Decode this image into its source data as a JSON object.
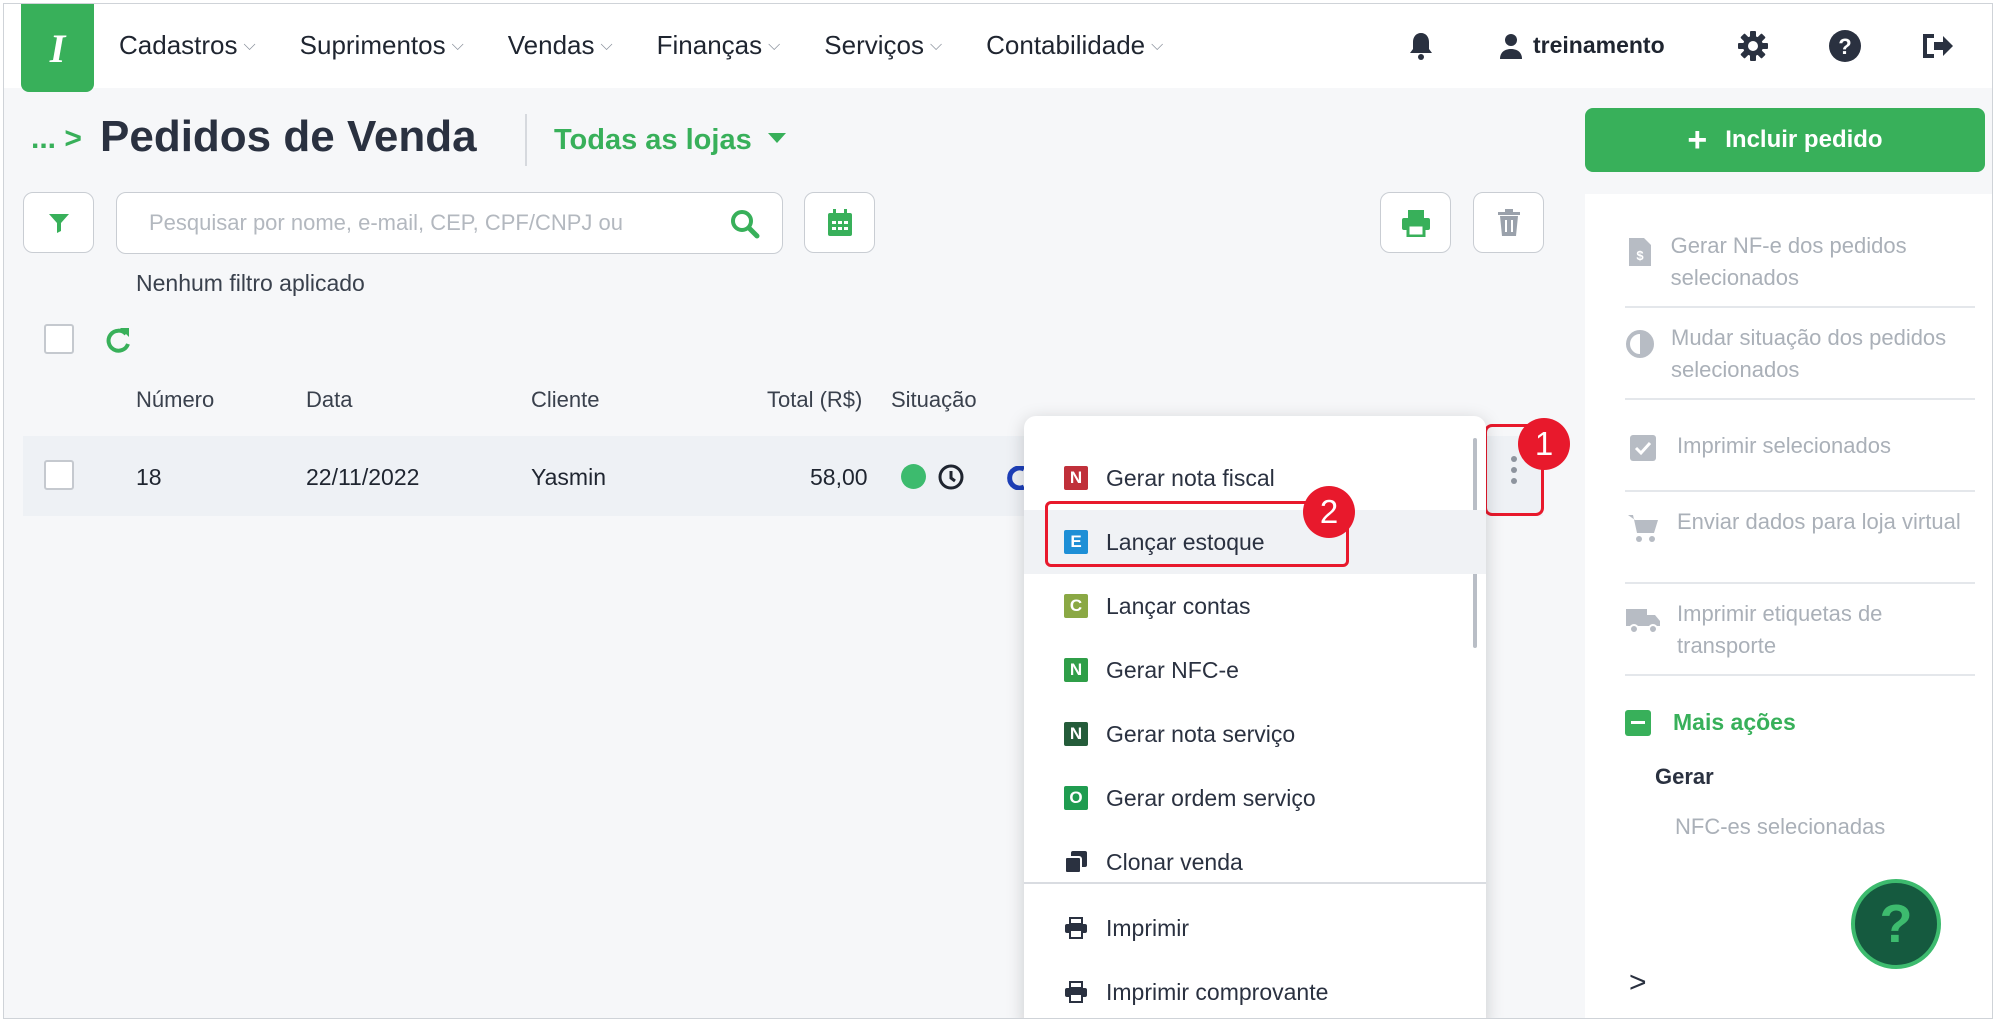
{
  "app": {
    "logo_letter": "I"
  },
  "nav": {
    "menu": [
      "Cadastros",
      "Suprimentos",
      "Vendas",
      "Finanças",
      "Serviços",
      "Contabilidade"
    ],
    "user": "treinamento"
  },
  "page": {
    "breadcrumb": "...",
    "title": "Pedidos de Venda",
    "store_selector": "Todas as lojas",
    "add_button": "Incluir pedido"
  },
  "toolbar": {
    "search_placeholder": "Pesquisar por nome, e-mail, CEP, CPF/CNPJ ou",
    "filter_status": "Nenhum filtro aplicado"
  },
  "table": {
    "columns": [
      "Número",
      "Data",
      "Cliente",
      "Total (R$)",
      "Situação"
    ],
    "rows": [
      {
        "numero": "18",
        "data": "22/11/2022",
        "cliente": "Yasmin",
        "total": "58,00",
        "status_color": "#3dbb6e"
      }
    ]
  },
  "dropdown": {
    "items": [
      {
        "label": "Gerar nota fiscal",
        "letter": "N",
        "color": "#c0303a"
      },
      {
        "label": "Lançar estoque",
        "letter": "E",
        "color": "#1e8fd6"
      },
      {
        "label": "Lançar contas",
        "letter": "C",
        "color": "#8aa844"
      },
      {
        "label": "Gerar NFC-e",
        "letter": "N",
        "color": "#2f9e48"
      },
      {
        "label": "Gerar nota serviço",
        "letter": "N",
        "color": "#245c3a"
      },
      {
        "label": "Gerar ordem serviço",
        "letter": "O",
        "color": "#1f9c50"
      },
      {
        "label": "Clonar venda",
        "icon": "clone-icon"
      },
      {
        "label": "Imprimir",
        "icon": "print-icon"
      },
      {
        "label": "Imprimir comprovante",
        "icon": "print-icon"
      }
    ]
  },
  "annotations": {
    "badge1": "1",
    "badge2": "2"
  },
  "sidebar": {
    "actions": [
      {
        "label": "Gerar NF-e dos pedidos selecionados",
        "icon": "invoice-file-icon"
      },
      {
        "label": "Mudar situação dos pedidos selecionados",
        "icon": "half-circle-icon"
      },
      {
        "label": "Imprimir selecionados",
        "icon": "checkbox-icon"
      },
      {
        "label": "Enviar dados para loja virtual",
        "icon": "cart-icon"
      },
      {
        "label": "Imprimir etiquetas de transporte",
        "icon": "truck-icon"
      }
    ],
    "more_actions": "Mais ações",
    "group": "Gerar",
    "group_item": "NFC-es selecionadas"
  },
  "help": {
    "label": "?"
  }
}
